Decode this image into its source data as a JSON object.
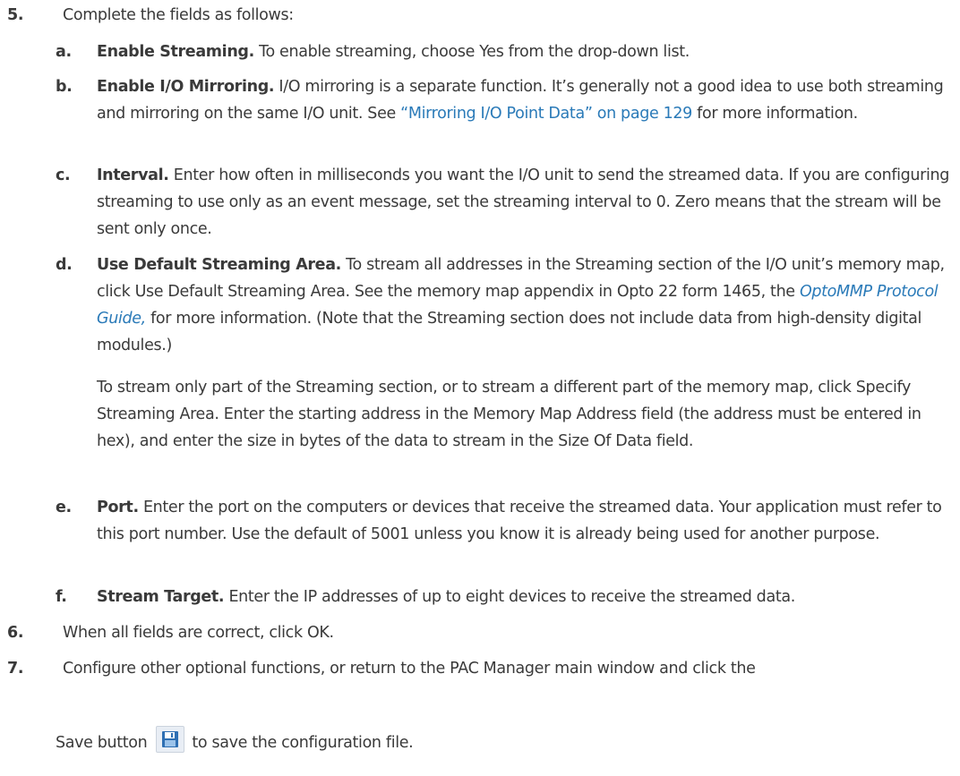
{
  "steps": {
    "s5": {
      "num": "5.",
      "text": "Complete the fields as follows:"
    },
    "s6": {
      "num": "6.",
      "text": "When all fields are correct, click OK."
    },
    "s7": {
      "num": "7.",
      "text": "Configure other optional functions, or return to the PAC Manager main window and click the",
      "line2_pre": "Save button",
      "line2_post": "to save the configuration file."
    }
  },
  "items": {
    "a": {
      "letter": "a.",
      "term": "Enable Streaming.",
      "text": " To enable streaming, choose Yes from the drop-down list."
    },
    "b": {
      "letter": "b.",
      "term": "Enable I/O Mirroring.",
      "text1": " I/O mirroring is a separate function. It’s generally not a good idea to use both streaming and mirroring on the same I/O unit. See ",
      "link": "“Mirroring I/O Point Data” on page 129",
      "text2": " for more information."
    },
    "c": {
      "letter": "c.",
      "term": "Interval.",
      "text": " Enter how often in milliseconds you want the I/O unit to send the streamed data. If you are configuring streaming to use only as an event message, set the streaming interval to 0. Zero means that the stream will be sent only once."
    },
    "d": {
      "letter": "d.",
      "term": "Use Default Streaming Area.",
      "text1": " To stream all addresses in the Streaming section of the I/O unit’s memory map, click Use Default Streaming Area. See the memory map appendix in Opto 22 form 1465, the ",
      "link": "OptoMMP Protocol Guide,",
      "text2": " for more information. (Note that the Streaming section does not include data from high-density digital modules.)",
      "para2": "To stream only part of the Streaming section, or to stream a different part of the memory map, click Specify Streaming Area. Enter the starting address in the Memory Map Address field (the address must be entered in hex), and enter the size in bytes of the data to stream in the Size Of Data field."
    },
    "e": {
      "letter": "e.",
      "term": "Port.",
      "text": " Enter the port on the computers or devices that receive the streamed data. Your application must refer to this port number. Use the default of 5001 unless you know it is already being used for another purpose."
    },
    "f": {
      "letter": "f.",
      "term": "Stream Target.",
      "text": " Enter the IP addresses of up to eight devices to receive the streamed data."
    }
  },
  "icons": {
    "save": "floppy-disk-icon"
  },
  "colors": {
    "text": "#3a3a3a",
    "link": "#2a7ab8",
    "icon_blue": "#2f6fb3"
  }
}
